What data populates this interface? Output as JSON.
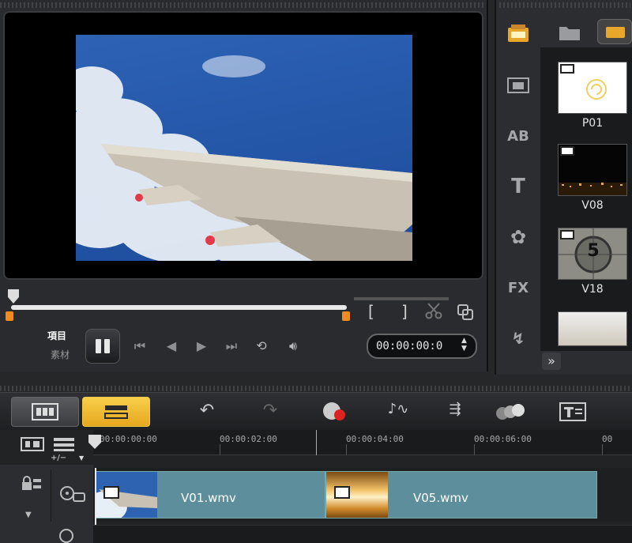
{
  "preview": {
    "mode_project": "項目",
    "mode_clip": "素材",
    "trim_in": "[",
    "trim_out": "]",
    "timecode": "00:00:00:0"
  },
  "library": {
    "items": [
      {
        "label": "P01"
      },
      {
        "label": "V08"
      },
      {
        "label": "V18",
        "countdown": "5"
      },
      {
        "label": ""
      }
    ],
    "tabs": [
      "media-icon",
      "instant-project-icon",
      "transition-icon",
      "title-icon",
      "graphic-icon",
      "filter-icon",
      "path-icon"
    ],
    "expand": "»"
  },
  "toolbar": {
    "add_remove": "+/−"
  },
  "timeline": {
    "ticks": [
      "00:00:00:00",
      "00:00:02:00",
      "00:00:04:00",
      "00:00:06:00"
    ],
    "clips": [
      {
        "name": "V01.wmv"
      },
      {
        "name": "V05.wmv"
      }
    ]
  },
  "colors": {
    "accent": "#f08c1e",
    "storyboard_active": "#f1b92a",
    "clip": "#5d8e9b"
  }
}
